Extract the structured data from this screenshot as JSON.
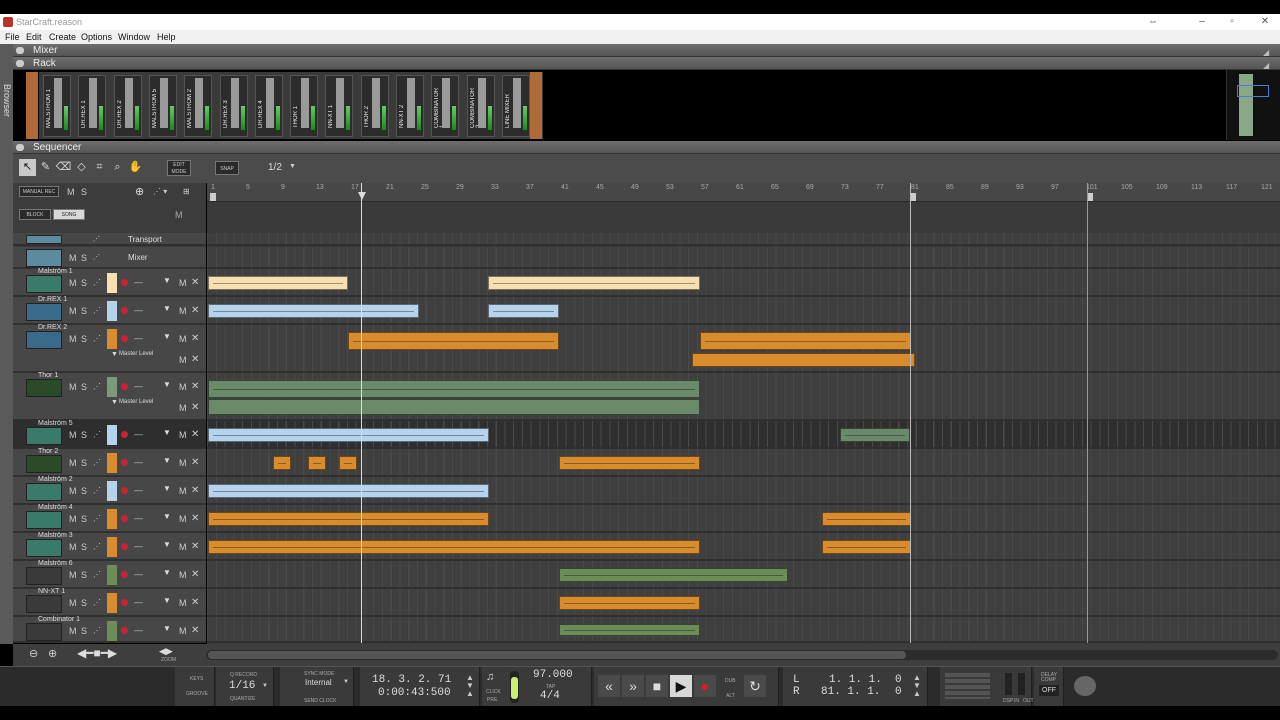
{
  "window": {
    "title": "StarCraft.reason"
  },
  "menu": [
    "File",
    "Edit",
    "Create",
    "Options",
    "Window",
    "Help"
  ],
  "browser_label": "Browser",
  "panels": {
    "mixer": "Mixer",
    "rack": "Rack",
    "sequencer": "Sequencer"
  },
  "rack_modules": [
    "MALSTROM 1",
    "DR.REX 1",
    "DR.REX 2",
    "MALSTROM 5",
    "MALSTROM 2",
    "DR.REX 3",
    "DR.REX 4",
    "THOR 1",
    "NN-XT 1",
    "THOR 2",
    "NN-XT 2",
    "COMBINATOR 1",
    "COMBINATOR 2",
    "LINE MIXER"
  ],
  "toolbar": {
    "edit_mode": "EDIT MODE",
    "snap": "SNAP",
    "snap_value": "1/2",
    "manual_rec": "MANUAL REC",
    "block": "BLOCK",
    "song": "SONG"
  },
  "ruler_ticks": [
    "1",
    "5",
    "9",
    "13",
    "17",
    "21",
    "25",
    "29",
    "33",
    "37",
    "41",
    "45",
    "49",
    "53",
    "57",
    "61",
    "65",
    "69",
    "73",
    "77",
    "81",
    "85",
    "89",
    "93",
    "97",
    "101",
    "105",
    "109",
    "113",
    "117",
    "121"
  ],
  "tracks": [
    {
      "name": "Transport"
    },
    {
      "name": "Mixer"
    },
    {
      "name": "Malström 1"
    },
    {
      "name": "Dr.REX 1"
    },
    {
      "name": "Dr.REX 2",
      "lane_label": "Master Level"
    },
    {
      "name": "Thor 1",
      "lane_label": "Master Level"
    },
    {
      "name": "Malström 5"
    },
    {
      "name": "Thor 2"
    },
    {
      "name": "Malström 2"
    },
    {
      "name": "Malström 4"
    },
    {
      "name": "Malström 3"
    },
    {
      "name": "Malström 6"
    },
    {
      "name": "NN-XT 1"
    },
    {
      "name": "Combinator 1"
    }
  ],
  "transport": {
    "keys": "KEYS",
    "groove": "GROOVE",
    "q_record": "Q RECORD",
    "quantize_value": "1/16",
    "quantize": "QUANTIZE",
    "sync_mode": "SYNC MODE",
    "sync_value": "Internal",
    "send_clock": "SEND CLOCK",
    "position_bars": "18. 3. 2. 71",
    "position_time": "0:00:43:500",
    "click": "CLICK",
    "pre": "PRE",
    "tempo": "97.000",
    "tap": "TAP",
    "signature": "4/4",
    "dub": "DUB",
    "alt": "ALT",
    "loop_left_label": "L",
    "loop_right_label": "R",
    "loop_left": "1. 1. 1.",
    "loop_left_tick": "0",
    "loop_right": "81. 1. 1.",
    "loop_right_tick": "0",
    "dsp": "DSP",
    "in": "IN",
    "out": "OUT",
    "delay_comp": "DELAY COMP",
    "delay_comp_state": "OFF",
    "zoom": "ZOOM"
  },
  "colors": {
    "cream": "#f6dfb0",
    "blue": "#b6d3ee",
    "orange": "#d88c2e",
    "green": "#6c8c58"
  }
}
